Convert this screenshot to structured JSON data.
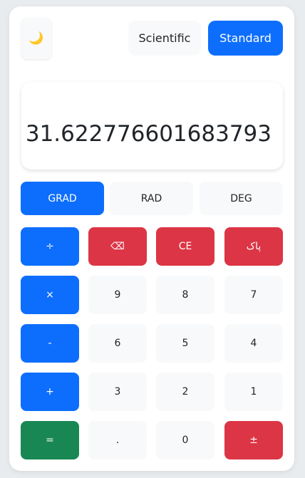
{
  "header": {
    "theme_icon": "moon-icon",
    "theme_glyph": "🌙",
    "scientific_label": "Scientific",
    "standard_label": "Standard"
  },
  "display": {
    "value": "31.622776601683793"
  },
  "angle_modes": {
    "grad": "GRAD",
    "rad": "RAD",
    "deg": "DEG",
    "selected": "GRAD"
  },
  "keys": {
    "divide": "÷",
    "backspace": "⌫",
    "ce": "CE",
    "clear": "پاک",
    "multiply": "×",
    "nine": "9",
    "eight": "8",
    "seven": "7",
    "subtract": "-",
    "six": "6",
    "five": "5",
    "four": "4",
    "add": "+",
    "three": "3",
    "two": "2",
    "one": "1",
    "equals": "=",
    "decimal": ".",
    "zero": "0",
    "negate": "±"
  },
  "colors": {
    "primary": "#0d6efd",
    "danger": "#dc3545",
    "success": "#198754",
    "light": "#f8f9fa"
  }
}
